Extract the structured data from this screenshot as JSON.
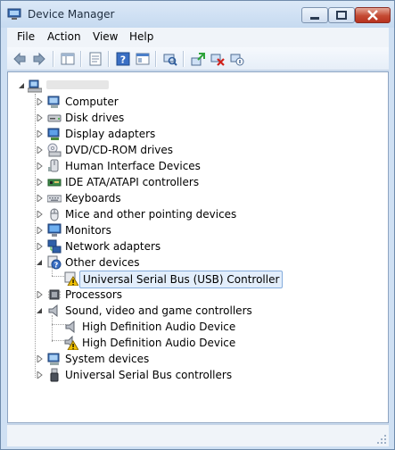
{
  "window": {
    "title": "Device Manager"
  },
  "menu": {
    "items": [
      "File",
      "Action",
      "View",
      "Help"
    ]
  },
  "toolbar": {
    "buttons": [
      "back-arrow-icon",
      "forward-arrow-icon",
      "show-hide-console-tree-icon",
      "properties-icon",
      "help-icon",
      "view-icon",
      "scan-hardware-changes-icon",
      "update-driver-icon",
      "uninstall-icon",
      "disable-icon"
    ]
  },
  "tree": {
    "root": {
      "label": "",
      "icon": "computer-root-icon"
    },
    "items": [
      {
        "label": "Computer",
        "icon": "computer-icon",
        "expanded": false
      },
      {
        "label": "Disk drives",
        "icon": "disk-drive-icon",
        "expanded": false
      },
      {
        "label": "Display adapters",
        "icon": "display-adapter-icon",
        "expanded": false
      },
      {
        "label": "DVD/CD-ROM drives",
        "icon": "dvd-drive-icon",
        "expanded": false
      },
      {
        "label": "Human Interface Devices",
        "icon": "hid-icon",
        "expanded": false
      },
      {
        "label": "IDE ATA/ATAPI controllers",
        "icon": "ide-controller-icon",
        "expanded": false
      },
      {
        "label": "Keyboards",
        "icon": "keyboard-icon",
        "expanded": false
      },
      {
        "label": "Mice and other pointing devices",
        "icon": "mouse-icon",
        "expanded": false
      },
      {
        "label": "Monitors",
        "icon": "monitor-icon",
        "expanded": false
      },
      {
        "label": "Network adapters",
        "icon": "network-adapter-icon",
        "expanded": false
      },
      {
        "label": "Other devices",
        "icon": "unknown-device-icon",
        "expanded": true,
        "children": [
          {
            "label": "Universal Serial Bus (USB) Controller",
            "icon": "warning-device-icon",
            "selected": true
          }
        ]
      },
      {
        "label": "Processors",
        "icon": "processor-icon",
        "expanded": false
      },
      {
        "label": "Sound, video and game controllers",
        "icon": "speaker-icon",
        "expanded": true,
        "children": [
          {
            "label": "High Definition Audio Device",
            "icon": "speaker-icon"
          },
          {
            "label": "High Definition Audio Device",
            "icon": "warning-speaker-icon"
          }
        ]
      },
      {
        "label": "System devices",
        "icon": "system-device-icon",
        "expanded": false
      },
      {
        "label": "Universal Serial Bus controllers",
        "icon": "usb-icon",
        "expanded": false
      }
    ]
  },
  "colors": {
    "selection_bg": "#e3eefb",
    "selection_border": "#84acdd",
    "warning": "#f2c200",
    "close_button": "#c44a33"
  }
}
